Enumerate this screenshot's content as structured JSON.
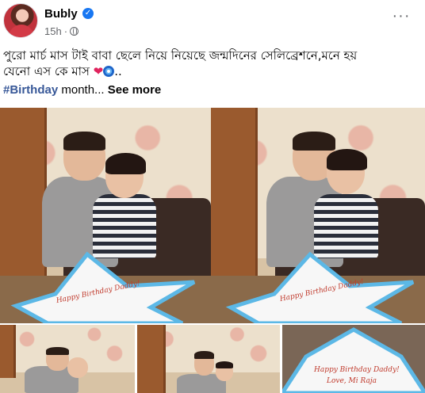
{
  "post": {
    "author": "Bubly",
    "verified_icon": "verified-badge-icon",
    "time": "15h",
    "audience_icon": "globe-icon",
    "more_label": "···",
    "caption_line1": "পুরো মার্চ মাস টাই বাবা ছেলে নিয়ে নিয়েছে জন্মদিনের সেলিব্রেশনে,মনে হয়",
    "caption_line2": "যেনো এস কে মাস",
    "caption_emoji": "❤️🧿..",
    "hashtag": "#Birthday",
    "after_hashtag": " month...",
    "see_more": "See more"
  },
  "cake_texts": {
    "main1": "Happy Birthday Daddy!",
    "main2": "Happy Birthday Daddy!",
    "small3_line1": "Happy Birthday Daddy!",
    "small3_line2": "Love, Mi Raja"
  },
  "colors": {
    "link": "#385898",
    "verified": "#1877f2",
    "secondary_text": "#65676b"
  }
}
